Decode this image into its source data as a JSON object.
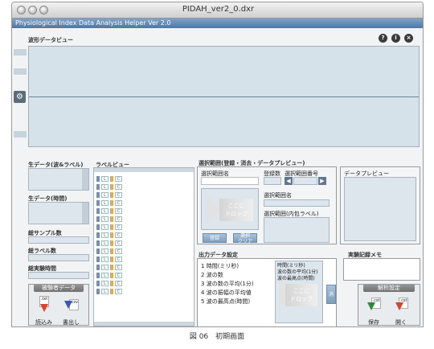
{
  "window": {
    "title": "PIDAH_ver2_0.dxr"
  },
  "app": {
    "title": "Physiological Index Data Analysis Helper Ver 2.0"
  },
  "waveform": {
    "label": "波形データビュー"
  },
  "raw": {
    "waves_label": "生データ(波&ラベル)",
    "time_label": "生データ(時間)",
    "total_samples": "総サンプル数",
    "total_labels": "総ラベル数",
    "total_time": "総実験時間"
  },
  "subject": {
    "title": "被験者データ",
    "load": "読込み",
    "export": "書出し",
    "load_file": ".txt",
    "export_file": ".csv"
  },
  "label_view": {
    "title": "ラベルビュー",
    "rows": 15,
    "l": "L",
    "c": "C"
  },
  "range": {
    "title": "選択範囲(登録・消去・データプレビュー)",
    "name_label": "選択範囲名",
    "drop_text": "ここに\nドロップ",
    "register": "登録",
    "clear": "選択\nクリア",
    "count_label": "登録数",
    "number_label": "選択範囲番号",
    "name2": "選択範囲名",
    "inner": "選択範囲(内包ラベル)"
  },
  "preview": {
    "title": "データプレビュー"
  },
  "output": {
    "title": "出力データ設定",
    "items": [
      "時間(ミリ秒)",
      "波の数",
      "波の数の平均(1分)",
      "波の振幅の平均値",
      "波の最高点(時間)"
    ],
    "numbers": [
      "1",
      "2",
      "3",
      "4",
      "5"
    ],
    "dropped": [
      "時間(ミリ秒)",
      "波の数の平均(1分)",
      "波の最高点(時間)"
    ],
    "drop_text": "ここに\nドロップ",
    "button": "消去"
  },
  "memo": {
    "title": "実験記録メモ"
  },
  "analysis": {
    "title": "解析設定",
    "save": "保存",
    "open": "開く",
    "save_file": ".cst",
    "open_file": ".cst"
  },
  "caption": "図 06　初期画面"
}
